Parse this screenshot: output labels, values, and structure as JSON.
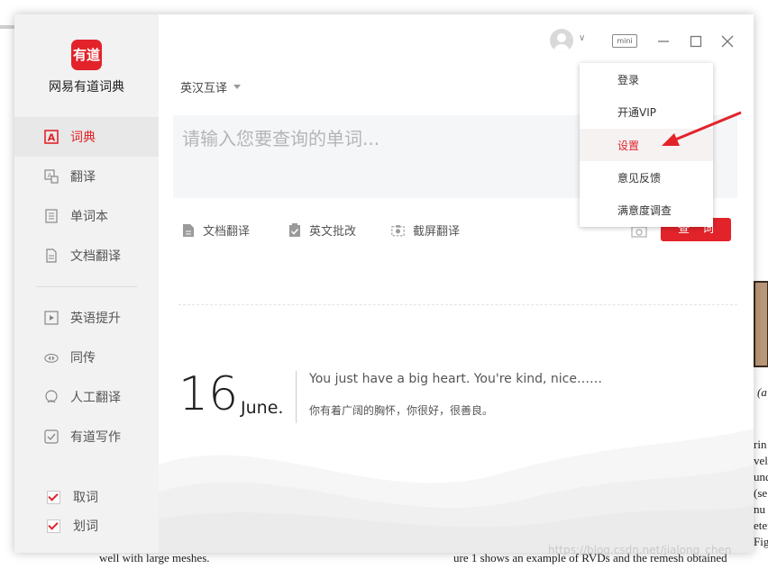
{
  "window": {
    "brand_color": "#e2232a"
  },
  "app": {
    "logo_text": "有道",
    "name": "网易有道词典"
  },
  "sidebar": {
    "items": [
      {
        "label": "词典",
        "icon": "dictionary-icon",
        "active": true
      },
      {
        "label": "翻译",
        "icon": "translate-icon"
      },
      {
        "label": "单词本",
        "icon": "wordbook-icon"
      },
      {
        "label": "文档翻译",
        "icon": "document-translate-icon"
      },
      {
        "label": "英语提升",
        "icon": "english-improve-icon"
      },
      {
        "label": "同传",
        "icon": "simultaneous-interpretation-icon"
      },
      {
        "label": "人工翻译",
        "icon": "human-translation-icon"
      },
      {
        "label": "有道写作",
        "icon": "writing-icon"
      }
    ],
    "checks": [
      {
        "label": "取词",
        "checked": true
      },
      {
        "label": "划词",
        "checked": true
      }
    ]
  },
  "titlebar": {
    "mini_label": "mini"
  },
  "main": {
    "lang_select": "英汉互译",
    "search_placeholder": "请输入您要查询的单词...",
    "tools": [
      {
        "label": "文档翻译",
        "icon": "document-icon"
      },
      {
        "label": "英文批改",
        "icon": "correction-icon"
      },
      {
        "label": "截屏翻译",
        "icon": "screenshot-icon"
      }
    ],
    "query_label": "查词"
  },
  "daily": {
    "day": "16",
    "month": "June.",
    "quote_en": "You just have a big heart. You're kind, nice……",
    "quote_cn": "你有着广阔的胸怀，你很好，很善良。"
  },
  "menu": {
    "items": [
      "登录",
      "开通VIP",
      "设置",
      "意见反馈",
      "满意度调查"
    ],
    "active_index": 2
  },
  "background_doc": {
    "lines": [
      "rin",
      "vell",
      "und",
      "(se",
      "nu",
      "eter",
      "Fig"
    ],
    "caption_fragment": "(a",
    "bottom_left": "well with large meshes.",
    "bottom_right": "ure 1 shows an example of RVDs and the remesh obtained",
    "watermark": "https://blog.csdn.net/jialong_chen"
  }
}
